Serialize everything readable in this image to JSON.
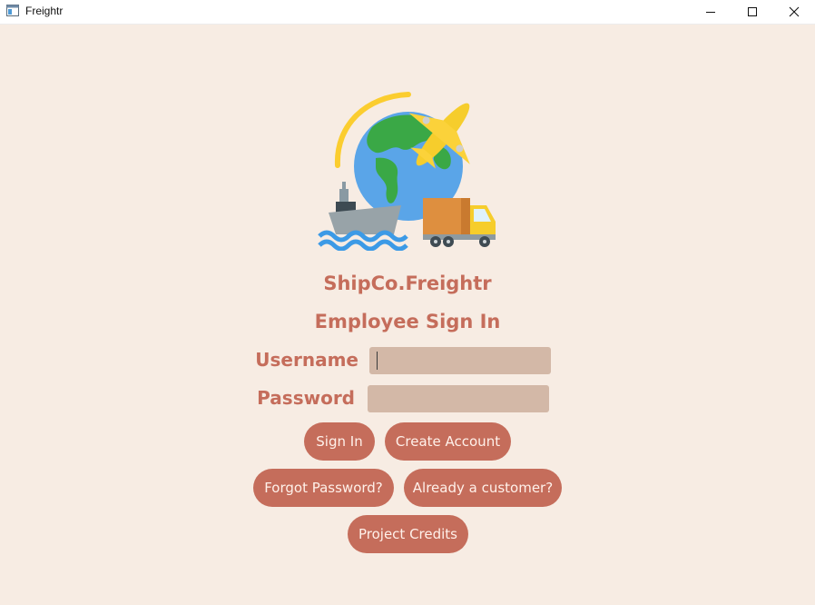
{
  "window": {
    "title": "Freightr",
    "minimize_icon": "minimize-icon",
    "maximize_icon": "maximize-icon",
    "close_icon": "close-icon"
  },
  "logo": {
    "icon": "freight-logo-globe-plane-ship-truck"
  },
  "app_name": "ShipCo.Freightr",
  "form_title": "Employee Sign In",
  "username": {
    "label": "Username",
    "value": ""
  },
  "password": {
    "label": "Password",
    "value": ""
  },
  "buttons": {
    "sign_in": "Sign In",
    "create_account": "Create Account",
    "forgot_password": "Forgot Password?",
    "already_customer": "Already a customer?",
    "project_credits": "Project Credits"
  },
  "colors": {
    "background": "#f7ece3",
    "accent": "#c56d5b",
    "field": "#d3b8a7",
    "button_text": "#fff1ea"
  }
}
